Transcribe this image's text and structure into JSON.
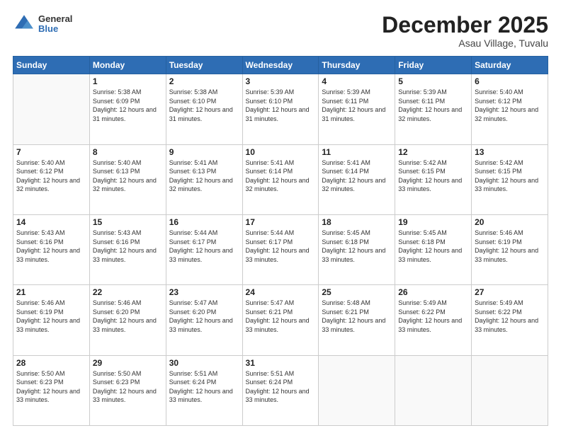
{
  "header": {
    "logo": {
      "general": "General",
      "blue": "Blue"
    },
    "title": "December 2025",
    "location": "Asau Village, Tuvalu"
  },
  "weekdays": [
    "Sunday",
    "Monday",
    "Tuesday",
    "Wednesday",
    "Thursday",
    "Friday",
    "Saturday"
  ],
  "weeks": [
    [
      {
        "day": "",
        "sunrise": "",
        "sunset": "",
        "daylight": ""
      },
      {
        "day": "1",
        "sunrise": "Sunrise: 5:38 AM",
        "sunset": "Sunset: 6:09 PM",
        "daylight": "Daylight: 12 hours and 31 minutes."
      },
      {
        "day": "2",
        "sunrise": "Sunrise: 5:38 AM",
        "sunset": "Sunset: 6:10 PM",
        "daylight": "Daylight: 12 hours and 31 minutes."
      },
      {
        "day": "3",
        "sunrise": "Sunrise: 5:39 AM",
        "sunset": "Sunset: 6:10 PM",
        "daylight": "Daylight: 12 hours and 31 minutes."
      },
      {
        "day": "4",
        "sunrise": "Sunrise: 5:39 AM",
        "sunset": "Sunset: 6:11 PM",
        "daylight": "Daylight: 12 hours and 31 minutes."
      },
      {
        "day": "5",
        "sunrise": "Sunrise: 5:39 AM",
        "sunset": "Sunset: 6:11 PM",
        "daylight": "Daylight: 12 hours and 32 minutes."
      },
      {
        "day": "6",
        "sunrise": "Sunrise: 5:40 AM",
        "sunset": "Sunset: 6:12 PM",
        "daylight": "Daylight: 12 hours and 32 minutes."
      }
    ],
    [
      {
        "day": "7",
        "sunrise": "Sunrise: 5:40 AM",
        "sunset": "Sunset: 6:12 PM",
        "daylight": "Daylight: 12 hours and 32 minutes."
      },
      {
        "day": "8",
        "sunrise": "Sunrise: 5:40 AM",
        "sunset": "Sunset: 6:13 PM",
        "daylight": "Daylight: 12 hours and 32 minutes."
      },
      {
        "day": "9",
        "sunrise": "Sunrise: 5:41 AM",
        "sunset": "Sunset: 6:13 PM",
        "daylight": "Daylight: 12 hours and 32 minutes."
      },
      {
        "day": "10",
        "sunrise": "Sunrise: 5:41 AM",
        "sunset": "Sunset: 6:14 PM",
        "daylight": "Daylight: 12 hours and 32 minutes."
      },
      {
        "day": "11",
        "sunrise": "Sunrise: 5:41 AM",
        "sunset": "Sunset: 6:14 PM",
        "daylight": "Daylight: 12 hours and 32 minutes."
      },
      {
        "day": "12",
        "sunrise": "Sunrise: 5:42 AM",
        "sunset": "Sunset: 6:15 PM",
        "daylight": "Daylight: 12 hours and 33 minutes."
      },
      {
        "day": "13",
        "sunrise": "Sunrise: 5:42 AM",
        "sunset": "Sunset: 6:15 PM",
        "daylight": "Daylight: 12 hours and 33 minutes."
      }
    ],
    [
      {
        "day": "14",
        "sunrise": "Sunrise: 5:43 AM",
        "sunset": "Sunset: 6:16 PM",
        "daylight": "Daylight: 12 hours and 33 minutes."
      },
      {
        "day": "15",
        "sunrise": "Sunrise: 5:43 AM",
        "sunset": "Sunset: 6:16 PM",
        "daylight": "Daylight: 12 hours and 33 minutes."
      },
      {
        "day": "16",
        "sunrise": "Sunrise: 5:44 AM",
        "sunset": "Sunset: 6:17 PM",
        "daylight": "Daylight: 12 hours and 33 minutes."
      },
      {
        "day": "17",
        "sunrise": "Sunrise: 5:44 AM",
        "sunset": "Sunset: 6:17 PM",
        "daylight": "Daylight: 12 hours and 33 minutes."
      },
      {
        "day": "18",
        "sunrise": "Sunrise: 5:45 AM",
        "sunset": "Sunset: 6:18 PM",
        "daylight": "Daylight: 12 hours and 33 minutes."
      },
      {
        "day": "19",
        "sunrise": "Sunrise: 5:45 AM",
        "sunset": "Sunset: 6:18 PM",
        "daylight": "Daylight: 12 hours and 33 minutes."
      },
      {
        "day": "20",
        "sunrise": "Sunrise: 5:46 AM",
        "sunset": "Sunset: 6:19 PM",
        "daylight": "Daylight: 12 hours and 33 minutes."
      }
    ],
    [
      {
        "day": "21",
        "sunrise": "Sunrise: 5:46 AM",
        "sunset": "Sunset: 6:19 PM",
        "daylight": "Daylight: 12 hours and 33 minutes."
      },
      {
        "day": "22",
        "sunrise": "Sunrise: 5:46 AM",
        "sunset": "Sunset: 6:20 PM",
        "daylight": "Daylight: 12 hours and 33 minutes."
      },
      {
        "day": "23",
        "sunrise": "Sunrise: 5:47 AM",
        "sunset": "Sunset: 6:20 PM",
        "daylight": "Daylight: 12 hours and 33 minutes."
      },
      {
        "day": "24",
        "sunrise": "Sunrise: 5:47 AM",
        "sunset": "Sunset: 6:21 PM",
        "daylight": "Daylight: 12 hours and 33 minutes."
      },
      {
        "day": "25",
        "sunrise": "Sunrise: 5:48 AM",
        "sunset": "Sunset: 6:21 PM",
        "daylight": "Daylight: 12 hours and 33 minutes."
      },
      {
        "day": "26",
        "sunrise": "Sunrise: 5:49 AM",
        "sunset": "Sunset: 6:22 PM",
        "daylight": "Daylight: 12 hours and 33 minutes."
      },
      {
        "day": "27",
        "sunrise": "Sunrise: 5:49 AM",
        "sunset": "Sunset: 6:22 PM",
        "daylight": "Daylight: 12 hours and 33 minutes."
      }
    ],
    [
      {
        "day": "28",
        "sunrise": "Sunrise: 5:50 AM",
        "sunset": "Sunset: 6:23 PM",
        "daylight": "Daylight: 12 hours and 33 minutes."
      },
      {
        "day": "29",
        "sunrise": "Sunrise: 5:50 AM",
        "sunset": "Sunset: 6:23 PM",
        "daylight": "Daylight: 12 hours and 33 minutes."
      },
      {
        "day": "30",
        "sunrise": "Sunrise: 5:51 AM",
        "sunset": "Sunset: 6:24 PM",
        "daylight": "Daylight: 12 hours and 33 minutes."
      },
      {
        "day": "31",
        "sunrise": "Sunrise: 5:51 AM",
        "sunset": "Sunset: 6:24 PM",
        "daylight": "Daylight: 12 hours and 33 minutes."
      },
      {
        "day": "",
        "sunrise": "",
        "sunset": "",
        "daylight": ""
      },
      {
        "day": "",
        "sunrise": "",
        "sunset": "",
        "daylight": ""
      },
      {
        "day": "",
        "sunrise": "",
        "sunset": "",
        "daylight": ""
      }
    ]
  ]
}
